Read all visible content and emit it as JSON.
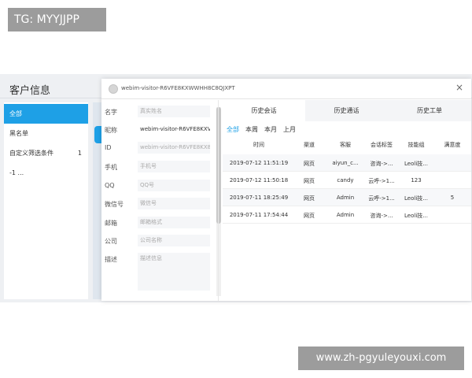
{
  "watermark_top": "TG: MYYJJPP",
  "watermark_bottom": "www.zh-pgyuleyouxi.com",
  "background": {
    "title": "客户信息",
    "sidebar": [
      {
        "label": "全部",
        "count": ""
      },
      {
        "label": "黑名单",
        "count": ""
      },
      {
        "label": "自定义筛选条件",
        "count": "1"
      },
      {
        "label": "-1 ...",
        "count": ""
      }
    ]
  },
  "modal": {
    "title": "webim-visitor-R6VFE8KXWWHH8C8QJXPT",
    "close": "×",
    "fields": [
      {
        "label": "名字",
        "value": "真实姓名",
        "filled": false
      },
      {
        "label": "昵称",
        "value": "webim-visitor-R6VFE8KXV",
        "filled": true
      },
      {
        "label": "ID",
        "value": "webim-visitor-R6VFE8KX8",
        "filled": false
      },
      {
        "label": "手机",
        "value": "手机号",
        "filled": false
      },
      {
        "label": "QQ",
        "value": "QQ号",
        "filled": false
      },
      {
        "label": "微信号",
        "value": "微信号",
        "filled": false
      },
      {
        "label": "邮箱",
        "value": "邮箱格式",
        "filled": false
      },
      {
        "label": "公司",
        "value": "公司名称",
        "filled": false
      },
      {
        "label": "描述",
        "value": "描述信息",
        "filled": false
      }
    ],
    "tabs": [
      "历史会话",
      "历史通话",
      "历史工单"
    ],
    "filters": [
      "全部",
      "本周",
      "本月",
      "上月"
    ],
    "columns": [
      "时间",
      "渠道",
      "客服",
      "会话标签",
      "技能组",
      "满意度"
    ],
    "rows": [
      [
        "2019-07-12 11:51:19",
        "网页",
        "aiyun_c...",
        "咨询->...",
        "Leoli技...",
        ""
      ],
      [
        "2019-07-12 11:50:18",
        "网页",
        "candy",
        "云呼->1...",
        "123",
        ""
      ],
      [
        "2019-07-11 18:25:49",
        "网页",
        "Admin",
        "云呼->1...",
        "Leoli技...",
        "5"
      ],
      [
        "2019-07-11 17:54:44",
        "网页",
        "Admin",
        "咨询->...",
        "Leoli技...",
        ""
      ]
    ]
  },
  "colors": {
    "accent": "#1ea0e6"
  }
}
